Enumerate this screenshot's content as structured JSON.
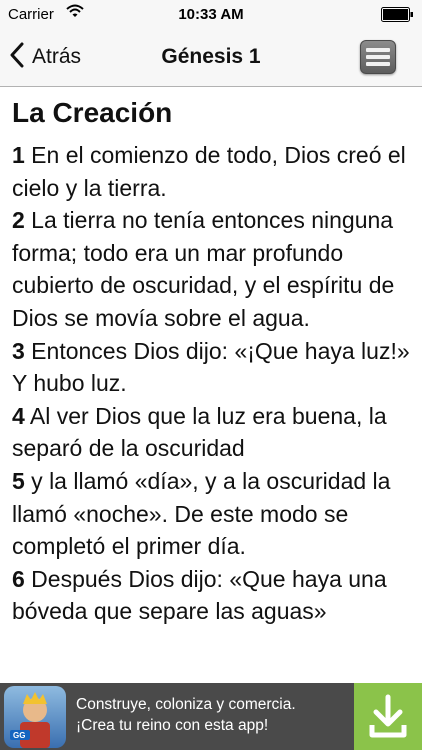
{
  "status_bar": {
    "carrier": "Carrier",
    "time": "10:33 AM"
  },
  "nav": {
    "back_label": "Atrás",
    "title": "Génesis 1",
    "menu_icon": "hamburger-menu-icon"
  },
  "chapter": {
    "heading": "La Creación",
    "verses": [
      {
        "num": "1",
        "text": " En el comienzo de todo, Dios creó el cielo y la tierra."
      },
      {
        "num": "2",
        "text": " La tierra no tenía entonces ninguna forma; todo era un mar profundo cubierto de oscuridad, y el espíritu de Dios se movía sobre el agua."
      },
      {
        "num": "3",
        "text": " Entonces Dios dijo: «¡Que haya luz!» Y hubo luz."
      },
      {
        "num": "4",
        "text": " Al ver Dios que la luz era buena, la separó de la oscuridad"
      },
      {
        "num": "5",
        "text": " y la llamó «día», y a la oscuridad la llamó «noche». De este modo se completó el primer día."
      },
      {
        "num": "6",
        "text": " Después Dios dijo: «Que haya una bóveda que separe las aguas»"
      }
    ]
  },
  "ad": {
    "line1": "Construye, coloniza y comercia.",
    "line2": "¡Crea tu reino con esta app!",
    "download_icon": "download-icon",
    "accent": "#8bc34a"
  }
}
